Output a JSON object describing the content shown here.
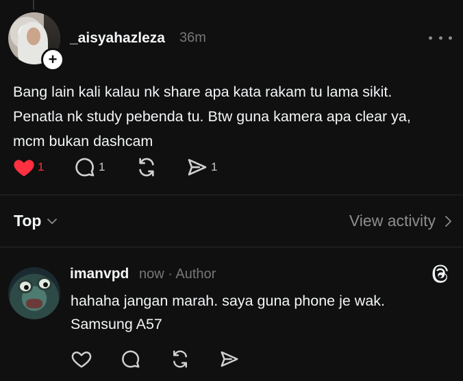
{
  "post": {
    "username": "_aisyahazleza",
    "timestamp": "36m",
    "text_lines": [
      "Bang lain kali kalau nk share apa kata rakam tu lama sikit.",
      "Penatla nk study pebenda tu. Btw guna kamera apa clear ya,",
      "mcm bukan dashcam"
    ],
    "likes": "1",
    "comments": "1",
    "shares": "1",
    "icons": {
      "avatar": "avatar",
      "follow": "plus-icon",
      "more": "more-dots-icon",
      "like": "heart-filled-icon",
      "comment": "comment-icon",
      "repost": "repost-icon",
      "share": "share-icon"
    }
  },
  "sort_bar": {
    "label": "Top",
    "view_activity": "View activity"
  },
  "reply": {
    "username": "imanvpd",
    "meta": "now · Author",
    "text_lines": [
      "hahaha jangan marah. saya guna phone je wak.",
      "Samsung A57"
    ],
    "icons": {
      "brand": "threads-icon",
      "like": "heart-outline-icon",
      "comment": "comment-icon",
      "repost": "repost-icon",
      "share": "share-icon"
    }
  },
  "colors": {
    "background": "#101010",
    "text": "#f3f5f7",
    "muted": "#777777",
    "like_red": "#ff3040",
    "divider": "#2a2a2a"
  }
}
